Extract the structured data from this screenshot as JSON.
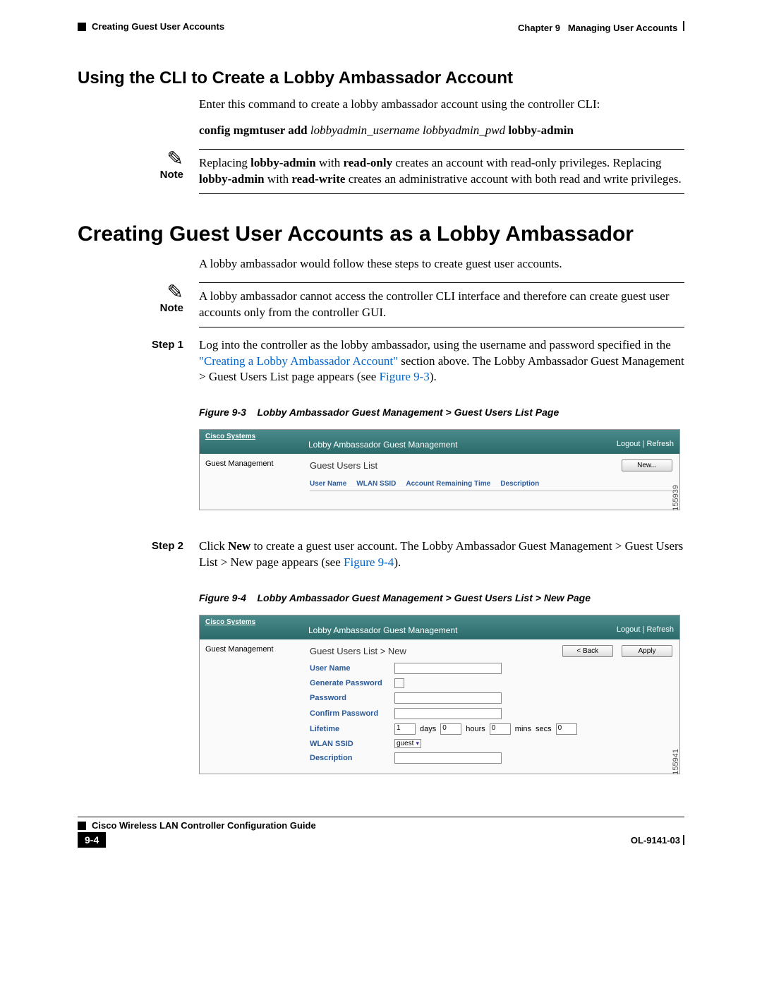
{
  "header": {
    "chapter": "Chapter 9",
    "chapter_title": "Managing User Accounts",
    "breadcrumb": "Creating Guest User Accounts"
  },
  "sec1": {
    "title": "Using the CLI to Create a Lobby Ambassador Account",
    "intro": "Enter this command to create a lobby ambassador account using the controller CLI:",
    "cmd_b1": "config mgmtuser add ",
    "cmd_i": "lobbyadmin_username lobbyadmin_pwd ",
    "cmd_b2": "lobby-admin",
    "note_label": "Note",
    "note_p1a": "Replacing ",
    "note_p1b": "lobby-admin",
    "note_p1c": " with ",
    "note_p1d": "read-only",
    "note_p1e": " creates an account with read-only privileges. Replacing ",
    "note_p1f": "lobby-admin",
    "note_p1g": " with ",
    "note_p1h": "read-write",
    "note_p1i": " creates an administrative account with both read and write privileges."
  },
  "sec2": {
    "title": "Creating Guest User Accounts as a Lobby Ambassador",
    "intro": "A lobby ambassador would follow these steps to create guest user accounts.",
    "note_label": "Note",
    "note_text": "A lobby ambassador cannot access the controller CLI interface and therefore can create guest user accounts only from the controller GUI."
  },
  "step1": {
    "label": "Step 1",
    "t1": "Log into the controller as the lobby ambassador, using the username and password specified in the ",
    "link": "\"Creating a Lobby Ambassador Account\"",
    "t2": " section above. The Lobby Ambassador Guest Management > Guest Users List page appears (see ",
    "figref": "Figure 9-3",
    "t3": ")."
  },
  "fig3": {
    "caption_num": "Figure 9-3",
    "caption_txt": "Lobby Ambassador Guest Management > Guest Users List Page",
    "logo": "Cisco Systems",
    "title": "Lobby Ambassador Guest Management",
    "logout": "Logout",
    "refresh": "Refresh",
    "side": "Guest Management",
    "main_title": "Guest Users List",
    "btn": "New...",
    "col1": "User Name",
    "col2": "WLAN SSID",
    "col3": "Account Remaining Time",
    "col4": "Description",
    "id": "155939"
  },
  "step2": {
    "label": "Step 2",
    "t1": "Click ",
    "b1": "New",
    "t2": " to create a guest user account. The Lobby Ambassador Guest Management > Guest Users List > New page appears (see ",
    "figref": "Figure 9-4",
    "t3": ")."
  },
  "fig4": {
    "caption_num": "Figure 9-4",
    "caption_txt": "Lobby Ambassador Guest Management > Guest Users List > New Page",
    "logo": "Cisco Systems",
    "title": "Lobby Ambassador Guest Management",
    "logout": "Logout",
    "refresh": "Refresh",
    "side": "Guest Management",
    "main_title": "Guest Users List > New",
    "btn_back": "< Back",
    "btn_apply": "Apply",
    "f_user": "User Name",
    "f_gen": "Generate Password",
    "f_pwd": "Password",
    "f_cpwd": "Confirm Password",
    "f_life": "Lifetime",
    "life_days_v": "1",
    "life_days_l": "days",
    "life_hours_v": "0",
    "life_hours_l": "hours",
    "life_mins_v": "0",
    "life_mins_l": "mins",
    "life_secs_l": "secs",
    "life_secs_v": "0",
    "f_ssid": "WLAN SSID",
    "ssid_val": "guest",
    "f_desc": "Description",
    "id": "155941"
  },
  "footer": {
    "book": "Cisco Wireless LAN Controller Configuration Guide",
    "page": "9-4",
    "doc": "OL-9141-03"
  }
}
